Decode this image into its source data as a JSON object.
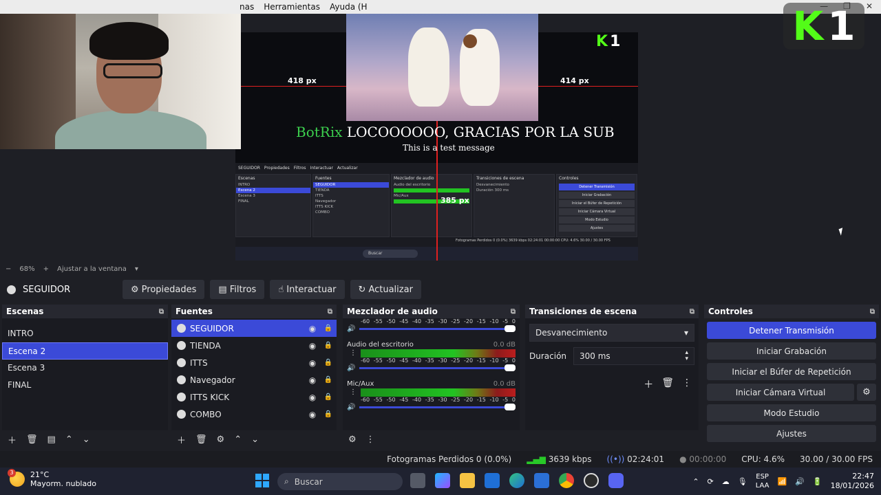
{
  "menubar": {
    "items": [
      "nas",
      "Herramientas",
      "Ayuda (H"
    ],
    "window_buttons": [
      "—",
      "❐",
      "✕"
    ]
  },
  "preview": {
    "overlay_brand": {
      "letter": "K",
      "number": "1"
    },
    "ruler_labels": {
      "left": "418 px",
      "right": "414 px",
      "vertical": "385 px"
    },
    "alert": {
      "bot_name": "BotRix",
      "message": "LOCOOOOOO, GRACIAS POR LA SUB",
      "sub_message": "This is a test message"
    },
    "mini_obs": {
      "source_name": "SEGUIDOR",
      "buttons": [
        "Propiedades",
        "Filtros",
        "Interactuar",
        "Actualizar"
      ],
      "scenes_title": "Escenas",
      "scenes": [
        "INTRO",
        "Escena 2",
        "Escena 3",
        "FINAL"
      ],
      "sources_title": "Fuentes",
      "sources": [
        "SEGUIDOR",
        "TIENDA",
        "ITTS",
        "Navegador",
        "ITTS KICK",
        "COMBO"
      ],
      "mixer_title": "Mezclador de audio",
      "mixer_tracks": [
        "Audio del escritorio",
        "Mic/Aux"
      ],
      "transitions_title": "Transiciones de escena",
      "transition": "Desvanecimiento",
      "duration_label": "Duración",
      "duration": "300 ms",
      "controls_title": "Controles",
      "controls": [
        "Detener Transmisión",
        "Iniciar Grabación",
        "Iniciar el Búfer de Repetición",
        "Iniciar Cámara Virtual",
        "Modo Estudio",
        "Ajustes"
      ],
      "status": "Fotogramas Perdidos 0 (0.0%)   3639 kbps   02:24:01   00:00:00   CPU: 4.6%   30.00 / 30.00 FPS",
      "taskbar_search": "Buscar"
    }
  },
  "zoom": {
    "minus": "−",
    "value": "68%",
    "plus": "+",
    "fit_label": "Ajustar a la ventana"
  },
  "source_toolbar": {
    "current_source": "SEGUIDOR",
    "buttons": {
      "properties": "Propiedades",
      "filters": "Filtros",
      "interact": "Interactuar",
      "refresh": "Actualizar"
    }
  },
  "scenes": {
    "title": "Escenas",
    "items": [
      "INTRO",
      "Escena 2",
      "Escena 3",
      "FINAL"
    ],
    "selected": "Escena 2"
  },
  "sources": {
    "title": "Fuentes",
    "items": [
      "SEGUIDOR",
      "TIENDA",
      "ITTS",
      "Navegador",
      "ITTS KICK",
      "COMBO"
    ],
    "selected": "SEGUIDOR"
  },
  "mixer": {
    "title": "Mezclador de audio",
    "scale": [
      "-60",
      "-55",
      "-50",
      "-45",
      "-40",
      "-35",
      "-30",
      "-25",
      "-20",
      "-15",
      "-10",
      "-5",
      "0"
    ],
    "tracks": [
      {
        "name": "Audio del escritorio",
        "db": "0.0 dB"
      },
      {
        "name": "Mic/Aux",
        "db": "0.0 dB"
      }
    ]
  },
  "transitions": {
    "title": "Transiciones de escena",
    "selected": "Desvanecimiento",
    "duration_label": "Duración",
    "duration": "300 ms"
  },
  "controls": {
    "title": "Controles",
    "stop_stream": "Detener Transmisión",
    "start_recording": "Iniciar Grabación",
    "start_replay": "Iniciar el Búfer de Repetición",
    "start_virtual_cam": "Iniciar Cámara Virtual",
    "studio_mode": "Modo Estudio",
    "settings": "Ajustes"
  },
  "status": {
    "dropped_frames": "Fotogramas Perdidos 0 (0.0%)",
    "bitrate": "3639 kbps",
    "stream_time": "02:24:01",
    "record_time": "00:00:00",
    "cpu": "CPU: 4.6%",
    "fps": "30.00 / 30.00 FPS"
  },
  "taskbar": {
    "weather_temp": "21°C",
    "weather_desc": "Mayorm. nublado",
    "weather_badge": "3",
    "search_placeholder": "Buscar",
    "lang_top": "ESP",
    "lang_bottom": "LAA",
    "time": "22:47",
    "date": "18/01/2026"
  },
  "colors": {
    "accent": "#3b4ad8",
    "kick_green": "#53fc18",
    "ruler_red": "#e02020",
    "meter_green": "#22c322"
  }
}
